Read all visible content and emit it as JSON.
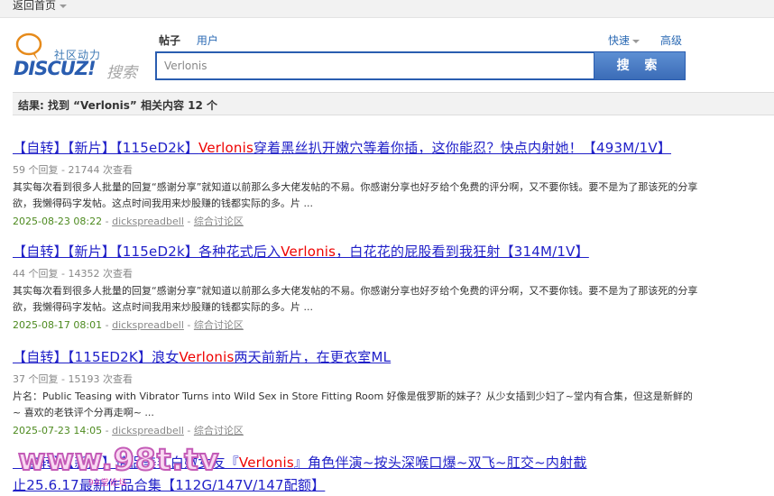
{
  "topbar": {
    "back_label": "返回首页"
  },
  "logo": {
    "slogan": "社区动力",
    "brand": "DISCUZ!",
    "brand_sub": "搜索"
  },
  "tabs": [
    {
      "label": "帖子"
    },
    {
      "label": "用户"
    }
  ],
  "links": {
    "quick": "快速",
    "advanced": "高级"
  },
  "search": {
    "value": "Verlonis",
    "button_label": "搜 索"
  },
  "result_summary": "结果: 找到 “Verlonis” 相关内容 12 个",
  "posts": [
    {
      "title_pre": "【自转】【新片】【115eD2k】",
      "title_hl": "Verlonis",
      "title_post": "穿着黑丝扒开嫩穴等着你插，这你能忍？快点内射她！【493M/1V】",
      "meta": "59 个回复 - 21744 次查看",
      "excerpt": "其实每次看到很多人批量的回复“感谢分享”就知道以前那么多大佬发帖的不易。你感谢分享也好歹给个免费的评分啊，又不要你钱。要不是为了那该死的分享欲，我懒得码字发帖。这点时间我用来炒股赚的钱都实际的多。片 ...",
      "date": "2025-08-23 08:22",
      "author": "dickspreadbell",
      "forum": "综合讨论区"
    },
    {
      "title_pre": "【自转】【新片】【115eD2k】各种花式后入",
      "title_hl": "Verlonis",
      "title_post": "，白花花的屁股看到我狂射【314M/1V】",
      "meta": "44 个回复 - 14352 次查看",
      "excerpt": "其实每次看到很多人批量的回复“感谢分享”就知道以前那么多大佬发帖的不易。你感谢分享也好歹给个免费的评分啊，又不要你钱。要不是为了那该死的分享欲，我懒得码字发帖。这点时间我用来炒股赚的钱都实际的多。片 ...",
      "date": "2025-08-17 08:01",
      "author": "dickspreadbell",
      "forum": "综合讨论区"
    },
    {
      "title_pre": "【自转】【115ED2K】浪女",
      "title_hl": "Verlonis",
      "title_post": "两天前新片，在更衣室ML",
      "meta": "37 个回复 - 15193 次查看",
      "excerpt": "片名：Public Teasing with Vibrator Turns into Wild Sex in Store Fitting Room 好像是俄罗斯的妹子？从少女插到少妇了~堂内有合集，但这是新鲜的~ 喜欢的老铁评个分再走啊~ ...",
      "date": "2025-07-23 14:05",
      "author": "dickspreadbell",
      "forum": "综合讨论区"
    },
    {
      "title_line1_pre": "【自转】【新片】情侣美乳白嫩女友『",
      "title_hl": "Verlonis",
      "title_line1_post": "』角色伴演~按头深喉口爆~双飞~肛交~内射截",
      "title_line2": "止25.6.17最新作品合集【112G/147V/147配额】"
    }
  ],
  "watermark": {
    "text": "www.98t.tv",
    "sub": "98堂论坛"
  }
}
